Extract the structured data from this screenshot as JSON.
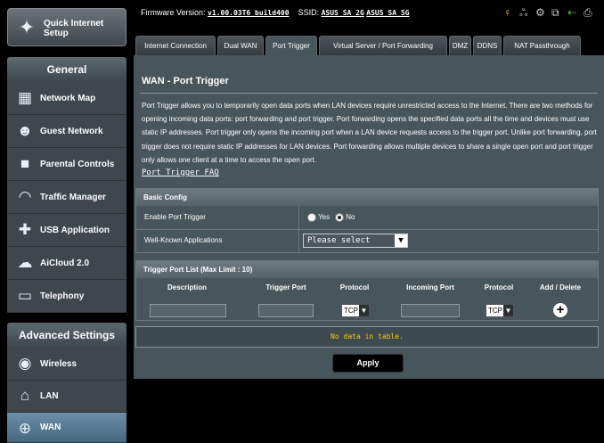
{
  "sidebar": {
    "quick_setup": "Quick Internet Setup",
    "general_header": "General",
    "general_items": [
      {
        "label": "Network Map",
        "icon": "network-map-icon"
      },
      {
        "label": "Guest Network",
        "icon": "guest-network-icon"
      },
      {
        "label": "Parental Controls",
        "icon": "lock-icon"
      },
      {
        "label": "Traffic Manager",
        "icon": "gauge-icon"
      },
      {
        "label": "USB Application",
        "icon": "puzzle-icon"
      },
      {
        "label": "AiCloud 2.0",
        "icon": "cloud-icon"
      },
      {
        "label": "Telephony",
        "icon": "monitor-icon"
      }
    ],
    "advanced_header": "Advanced Settings",
    "advanced_items": [
      {
        "label": "Wireless",
        "icon": "wifi-icon"
      },
      {
        "label": "LAN",
        "icon": "home-icon"
      },
      {
        "label": "WAN",
        "icon": "globe-icon",
        "selected": true
      }
    ]
  },
  "header": {
    "firmware_label": "Firmware Version:",
    "firmware_value": "v1.00.03T6_build400",
    "ssid_label": "SSID:",
    "ssid_values": [
      "ASUS_SA_2G",
      "ASUS_SA_5G"
    ]
  },
  "tabs": [
    "Internet Connection",
    "Dual WAN",
    "Port Trigger",
    "Virtual Server / Port Forwarding",
    "DMZ",
    "DDNS",
    "NAT Passthrough"
  ],
  "active_tab": "Port Trigger",
  "page": {
    "title": "WAN - Port Trigger",
    "description": "Port Trigger allows you to temporarily open data ports when LAN devices require unrestricted access to the Internet. There are two methods for opening incoming data ports: port forwarding and port trigger. Port forwarding opens the specified data ports all the time and devices must use static IP addresses. Port trigger only opens the incoming port when a LAN device requests access to the trigger port. Unlike port forwarding, port trigger does not require static IP addresses for LAN devices. Port forwarding allows multiple devices to share a single open port and port trigger only allows one client at a time to access the open port.",
    "faq_link": "Port_Trigger_FAQ"
  },
  "basic_config": {
    "header": "Basic Config",
    "enable_label": "Enable Port Trigger",
    "yes_label": "Yes",
    "no_label": "No",
    "enabled": "No",
    "apps_label": "Well-Known Applications",
    "apps_selected": "Please select"
  },
  "trigger_list": {
    "header": "Trigger Port List (Max Limit : 10)",
    "columns": [
      "Description",
      "Trigger Port",
      "Protocol",
      "Incoming Port",
      "Protocol",
      "Add / Delete"
    ],
    "protocol_default": "TCP",
    "empty_text": "No data in table."
  },
  "apply_label": "Apply"
}
